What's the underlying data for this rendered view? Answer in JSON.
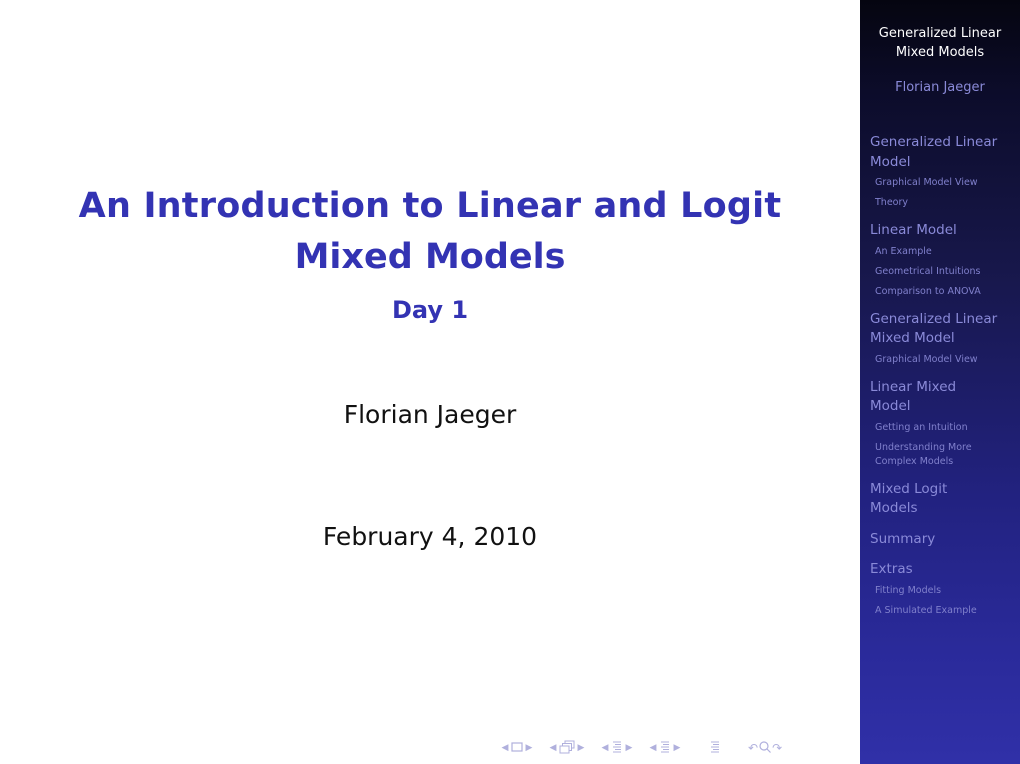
{
  "slide": {
    "title_line1": "An Introduction to Linear and Logit",
    "title_line2": "Mixed Models",
    "subtitle": "Day 1",
    "author": "Florian Jaeger",
    "date": "February 4, 2010"
  },
  "sidebar": {
    "title_line1": "Generalized Linear",
    "title_line2": "Mixed Models",
    "author": "Florian Jaeger",
    "sections": [
      {
        "label_line1": "Generalized Linear",
        "label_line2": "Model",
        "subsections": [
          "Graphical Model View",
          "Theory"
        ]
      },
      {
        "label_line1": "Linear Model",
        "label_line2": "",
        "subsections": [
          "An Example",
          "Geometrical Intuitions",
          "Comparison to ANOVA"
        ]
      },
      {
        "label_line1": "Generalized Linear",
        "label_line2": "Mixed Model",
        "subsections": [
          "Graphical Model View"
        ]
      },
      {
        "label_line1": "Linear Mixed",
        "label_line2": "Model",
        "subsections": [
          "Getting an Intuition",
          "Understanding More",
          "Complex Models"
        ]
      },
      {
        "label_line1": "Mixed Logit",
        "label_line2": "Models",
        "subsections": []
      },
      {
        "label_line1": "Summary",
        "label_line2": "",
        "subsections": []
      },
      {
        "label_line1": "Extras",
        "label_line2": "",
        "subsections": [
          "Fitting Models",
          "A Simulated Example"
        ]
      }
    ]
  },
  "navigation": {
    "icons": [
      "nav-prev-frame",
      "frame-icon",
      "nav-next-frame",
      "nav-prev-subsection",
      "subsection-icon",
      "nav-next-subsection",
      "nav-prev-section",
      "section-icon",
      "nav-next-section",
      "nav-prev-document",
      "document-icon",
      "nav-next-document",
      "presentation-icon",
      "back-icon",
      "search-icon",
      "forward-icon"
    ]
  },
  "colors": {
    "title": "#3333b3",
    "sidebar_text": "#8a8ad8",
    "sidebar_title": "#ffffff",
    "nav_icons": "#b0b0dd"
  }
}
